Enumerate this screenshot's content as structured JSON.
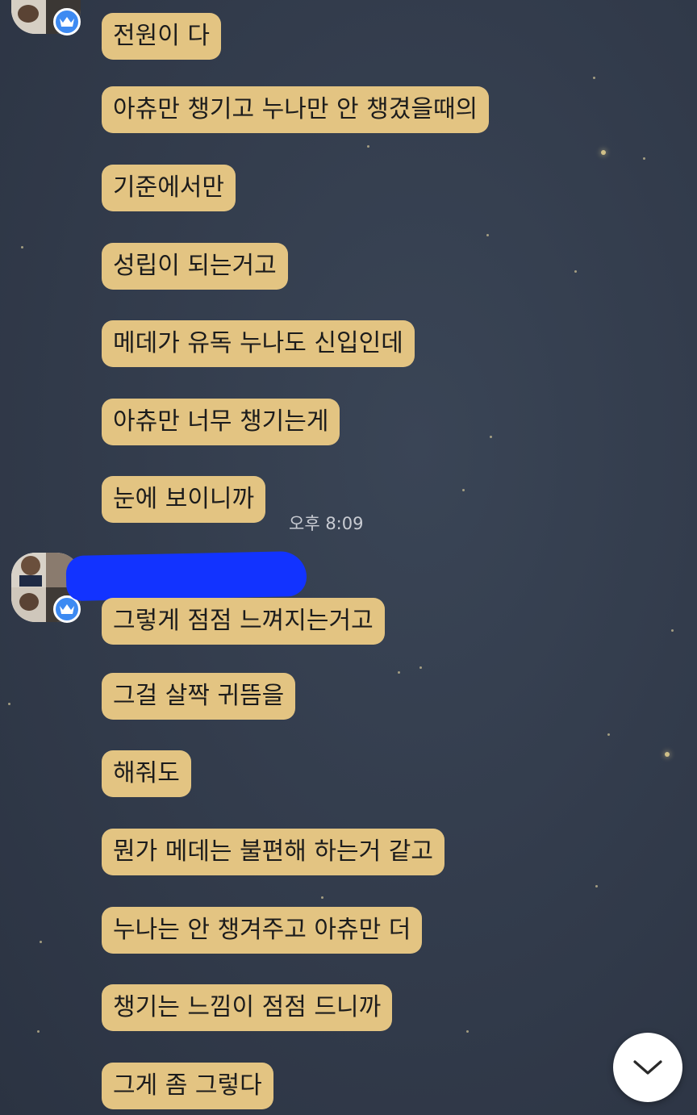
{
  "chat": {
    "timestamp": "오후 8:09",
    "first_group": [
      "전원이 다",
      "아츄만 챙기고 누나만 안 챙겼을때의",
      "기준에서만",
      "성립이 되는거고",
      "메데가 유독 누나도 신입인데",
      "아츄만 너무 챙기는게",
      "눈에 보이니까"
    ],
    "second_group": [
      "그렇게 점점 느껴지는거고",
      "그걸 살짝 귀뜸을",
      "해줘도",
      "뭔가 메데는 불편해 하는거 같고",
      "누나는 안 챙겨주고 아츄만 더",
      "챙기는 느낌이 점점 드니까",
      "그게 좀 그렇다"
    ]
  },
  "icons": {
    "avatar_badge": "crown-icon",
    "scroll_button": "chevron-down-icon"
  },
  "colors": {
    "bubble": "#e3c482",
    "background": "#323b4b",
    "badge": "#3d8af2",
    "redaction": "#1233ff"
  }
}
